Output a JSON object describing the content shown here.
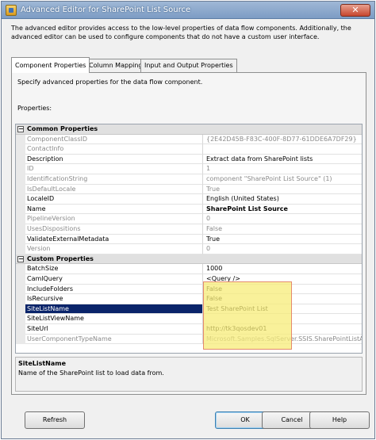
{
  "window": {
    "title": "Advanced Editor for SharePoint List Source",
    "description": "The advanced editor provides access to the low-level properties of data flow components. Additionally, the advanced editor can be used to configure components that do not have a custom user interface."
  },
  "tabs": [
    {
      "label": "Component Properties"
    },
    {
      "label": "Column Mappings"
    },
    {
      "label": "Input and Output Properties"
    }
  ],
  "panel": {
    "instruction": "Specify advanced properties for the data flow component.",
    "properties_label": "Properties:"
  },
  "grid": {
    "common_category": "Common Properties",
    "custom_category": "Custom Properties",
    "common_rows": [
      {
        "name": "ComponentClassID",
        "value": "{2E42D45B-F83C-400F-8D77-61DDE6A7DF29}",
        "disabled": true
      },
      {
        "name": "ContactInfo",
        "value": "",
        "disabled": true
      },
      {
        "name": "Description",
        "value": "Extract data from SharePoint lists",
        "disabled": false
      },
      {
        "name": "ID",
        "value": "1",
        "disabled": true
      },
      {
        "name": "IdentificationString",
        "value": "component \"SharePoint List Source\" (1)",
        "disabled": true
      },
      {
        "name": "IsDefaultLocale",
        "value": "True",
        "disabled": true
      },
      {
        "name": "LocaleID",
        "value": "English (United States)",
        "disabled": false
      },
      {
        "name": "Name",
        "value": "SharePoint List Source",
        "disabled": false,
        "bold": true
      },
      {
        "name": "PipelineVersion",
        "value": "0",
        "disabled": true
      },
      {
        "name": "UsesDispositions",
        "value": "False",
        "disabled": true
      },
      {
        "name": "ValidateExternalMetadata",
        "value": "True",
        "disabled": false
      },
      {
        "name": "Version",
        "value": "0",
        "disabled": true
      }
    ],
    "custom_rows": [
      {
        "name": "BatchSize",
        "value": "1000",
        "disabled": false
      },
      {
        "name": "CamlQuery",
        "value": "<Query />",
        "disabled": false
      },
      {
        "name": "IncludeFolders",
        "value": "False",
        "disabled": false
      },
      {
        "name": "IsRecursive",
        "value": "False",
        "disabled": false
      },
      {
        "name": "SiteListName",
        "value": "Test SharePoint List",
        "disabled": false,
        "selected": true
      },
      {
        "name": "SiteListViewName",
        "value": "",
        "disabled": false
      },
      {
        "name": "SiteUrl",
        "value": "http://tk3qosdev01",
        "disabled": false
      },
      {
        "name": "UserComponentTypeName",
        "value": "Microsoft.Samples.SqlServer.SSIS.SharePointListAdapters",
        "disabled": true
      }
    ]
  },
  "help": {
    "title": "SiteListName",
    "text": "Name of the SharePoint list to load data from."
  },
  "buttons": {
    "refresh": "Refresh",
    "ok": "OK",
    "cancel": "Cancel",
    "help": "Help",
    "close": "✕"
  },
  "colors": {
    "selection": "#0a246a",
    "highlight": "#f7ec78",
    "highlight_border": "#e58a6c"
  }
}
